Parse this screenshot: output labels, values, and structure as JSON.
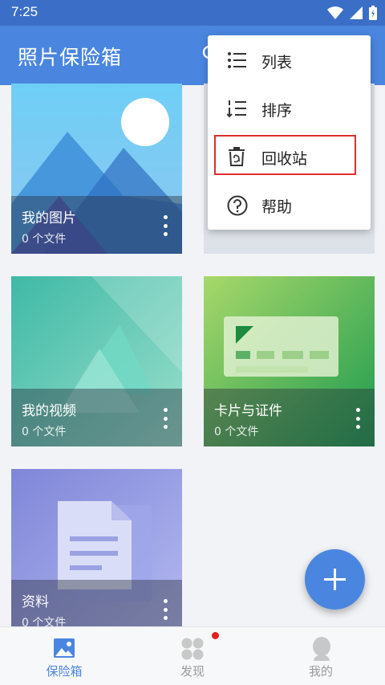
{
  "status_bar": {
    "time": "7:25"
  },
  "app_bar": {
    "title": "照片保险箱"
  },
  "albums": [
    {
      "name": "我的图片",
      "count": "0 个文件"
    },
    {
      "name": "我的视频",
      "count": "0 个文件"
    },
    {
      "name": "卡片与证件",
      "count": "0 个文件"
    },
    {
      "name": "资料",
      "count": "0 个文件"
    }
  ],
  "menu": {
    "items": [
      {
        "label": "列表",
        "icon": "list-icon"
      },
      {
        "label": "排序",
        "icon": "sort-icon"
      },
      {
        "label": "回收站",
        "icon": "trash-icon"
      },
      {
        "label": "帮助",
        "icon": "help-icon"
      }
    ],
    "highlighted": "回收站"
  },
  "bottom_nav": {
    "items": [
      {
        "label": "保险箱",
        "icon": "image-icon",
        "active": true
      },
      {
        "label": "发现",
        "icon": "apps-icon",
        "badge": true
      },
      {
        "label": "我的",
        "icon": "person-icon"
      }
    ]
  },
  "colors": {
    "primary": "#4a86e0",
    "status_bar": "#3b6fc7",
    "highlight": "#e02d2d"
  }
}
